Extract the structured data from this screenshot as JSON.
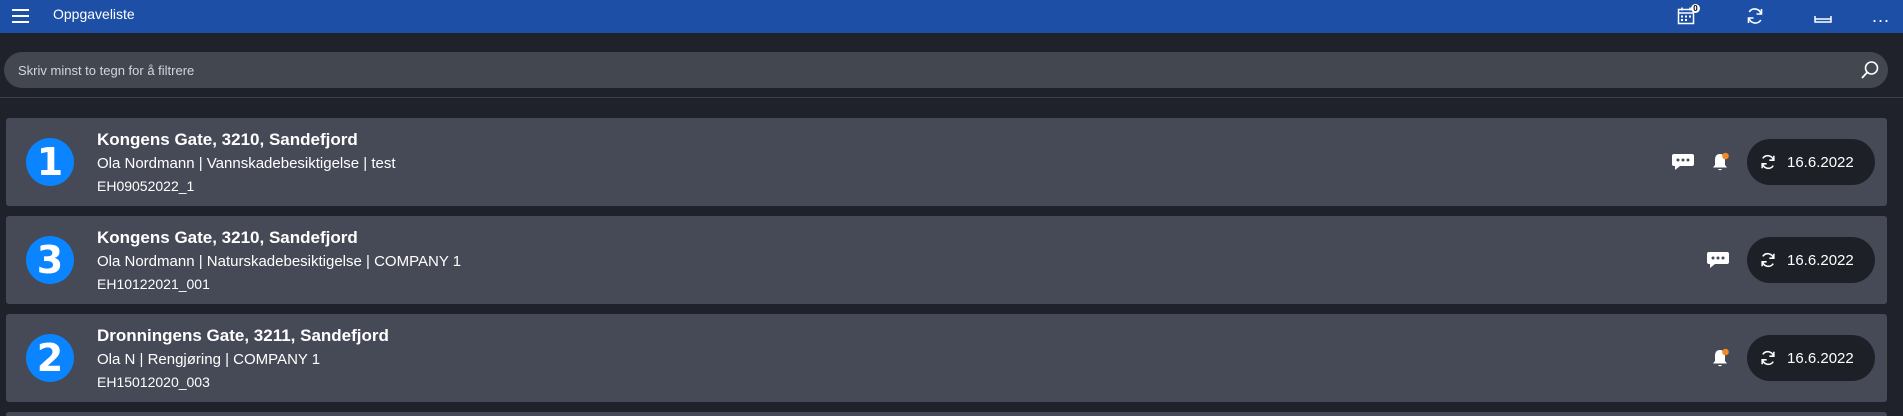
{
  "header": {
    "title": "Oppgaveliste",
    "calendar_badge": "0",
    "menu_icon": "hamburger-icon",
    "calendar_icon": "calendar-icon",
    "refresh_icon": "refresh-icon",
    "tray_icon": "tray-icon",
    "more_icon": "more-icon",
    "more_label": "..."
  },
  "filter": {
    "placeholder": "Skriv minst to tegn for å filtrere",
    "value": "",
    "search_icon": "search-icon"
  },
  "colors": {
    "header_bg": "#1e4fa6",
    "page_bg": "#1f222a",
    "card_bg": "#464a56",
    "badge_blue": "#0a84ff",
    "notification_dot": "#f08a24",
    "pill_bg": "#1d2027"
  },
  "tasks": [
    {
      "number": "1",
      "address": "Kongens Gate, 3210, Sandefjord",
      "details": "Ola Nordmann | Vannskadebesiktigelse | test",
      "id": "EH09052022_1",
      "has_comment": true,
      "has_notification": true,
      "date": "16.6.2022"
    },
    {
      "number": "3",
      "address": "Kongens Gate, 3210, Sandefjord",
      "details": "Ola Nordmann | Naturskadebesiktigelse | COMPANY 1",
      "id": "EH10122021_001",
      "has_comment": true,
      "has_notification": false,
      "date": "16.6.2022"
    },
    {
      "number": "2",
      "address": "Dronningens Gate, 3211, Sandefjord",
      "details": "Ola N | Rengjøring | COMPANY 1",
      "id": "EH15012020_003",
      "has_comment": false,
      "has_notification": true,
      "date": "16.6.2022"
    }
  ]
}
